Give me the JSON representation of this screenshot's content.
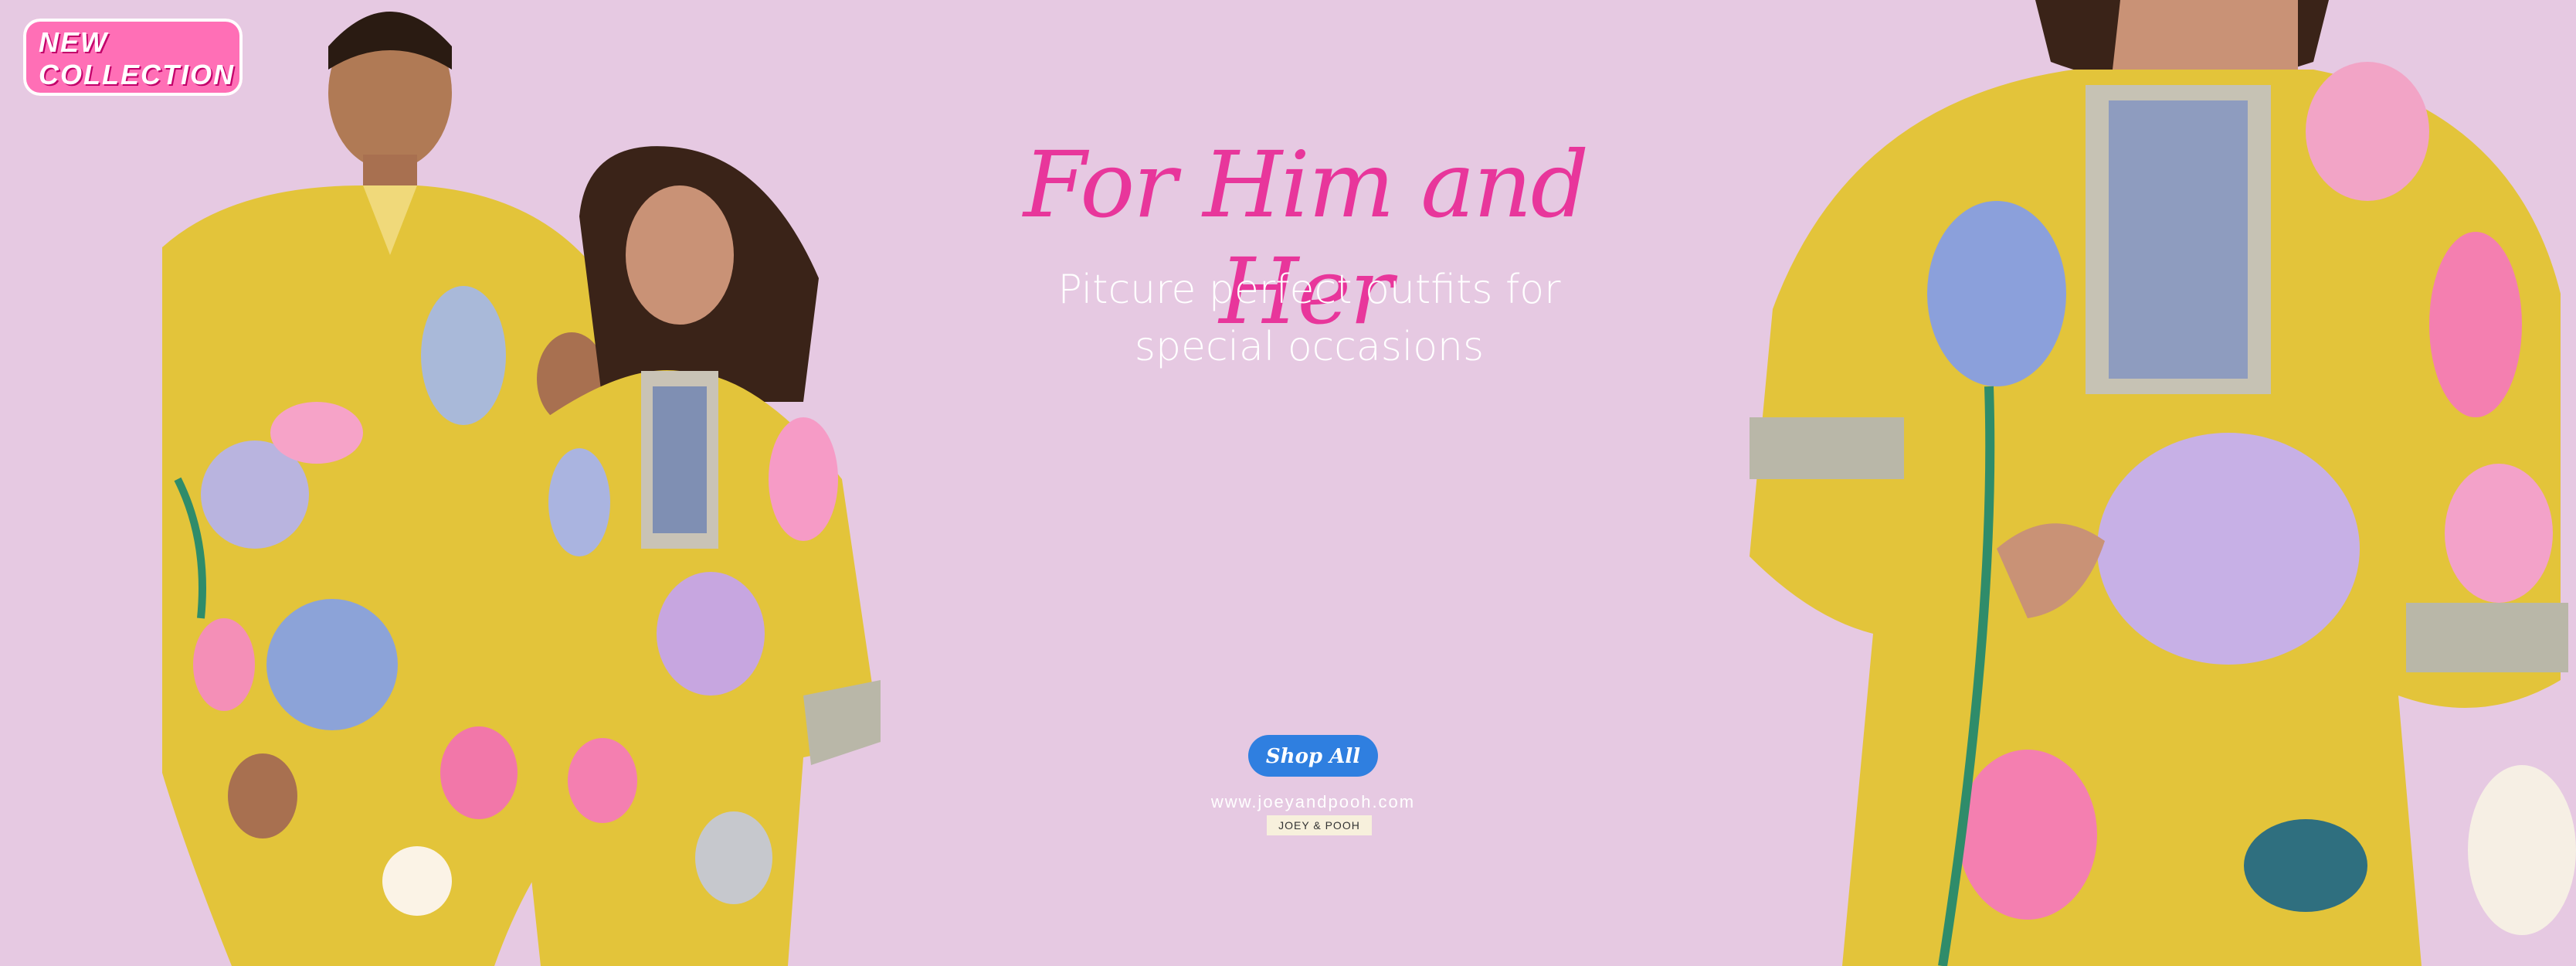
{
  "badge": {
    "line1": "NEW",
    "line2": "COLLECTION"
  },
  "hero": {
    "headline": "For Him and Her",
    "subtitle": "Pitcure perfect outfits for special occasions",
    "cta_label": "Shop All",
    "website": "www.joeyandpooh.com",
    "brand": "JOEY & POOH"
  },
  "colors": {
    "background": "#e6c9e2",
    "headline": "#e8369b",
    "cta": "#2f7fe0",
    "badge": "#ff6fb6",
    "garment": "#e3c43a"
  }
}
